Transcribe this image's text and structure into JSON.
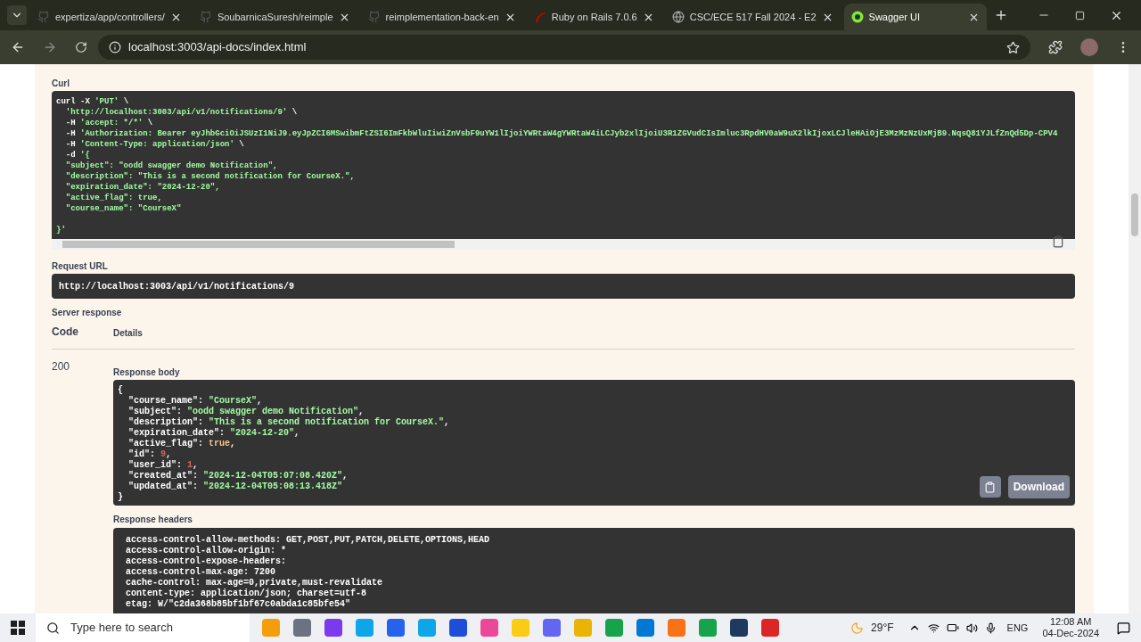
{
  "browser": {
    "tabs": [
      {
        "title": "expertiza/app/controllers/",
        "selected": false
      },
      {
        "title": "SoubarnicaSuresh/reimple",
        "selected": false
      },
      {
        "title": "reimplementation-back-en",
        "selected": false
      },
      {
        "title": "Ruby on Rails 7.0.6",
        "selected": false
      },
      {
        "title": "CSC/ECE 517 Fall 2024 - E2",
        "selected": false
      },
      {
        "title": "Swagger UI",
        "selected": true
      }
    ],
    "address": "localhost:3003/api-docs/index.html"
  },
  "curl": {
    "label": "Curl",
    "lines": [
      [
        {
          "t": "curl -X ",
          "kind": "plain"
        },
        {
          "t": "'PUT'",
          "kind": "str"
        },
        {
          "t": " \\",
          "kind": "plain"
        }
      ],
      [
        {
          "t": "  'http://localhost:3003/api/v1/notifications/9'",
          "kind": "str"
        },
        {
          "t": " \\",
          "kind": "plain"
        }
      ],
      [
        {
          "t": "  -H ",
          "kind": "plain"
        },
        {
          "t": "'accept: */*'",
          "kind": "str"
        },
        {
          "t": " \\",
          "kind": "plain"
        }
      ],
      [
        {
          "t": "  -H ",
          "kind": "plain"
        },
        {
          "t": "'Authorization: Bearer eyJhbGciOiJSUzI1NiJ9.eyJpZCI6MSwibmFtZSI6ImFkbWluIiwiZnVsbF9uYW1lIjoiYWRtaW4gYWRtaW4iLCJyb2xlIjoiU3R1ZGVudCIsImluc3RpdHV0aW9uX2lkIjoxLCJleHAiOjE3MzMzNzUxMjB9.NqsQ81YJLfZnQd5Dp-CPV4",
          "kind": "str"
        }
      ],
      [
        {
          "t": "  -H ",
          "kind": "plain"
        },
        {
          "t": "'Content-Type: application/json'",
          "kind": "str"
        },
        {
          "t": " \\",
          "kind": "plain"
        }
      ],
      [
        {
          "t": "  -d ",
          "kind": "plain"
        },
        {
          "t": "'{",
          "kind": "str"
        }
      ],
      [
        {
          "t": "  \"subject\": \"oodd swagger demo Notification\",",
          "kind": "str"
        }
      ],
      [
        {
          "t": "  \"description\": \"This is a second notification for CourseX.\",",
          "kind": "str"
        }
      ],
      [
        {
          "t": "  \"expiration_date\": \"2024-12-20\",",
          "kind": "str"
        }
      ],
      [
        {
          "t": "  \"active_flag\": true,",
          "kind": "str"
        }
      ],
      [
        {
          "t": "  \"course_name\": \"CourseX\"",
          "kind": "str"
        }
      ]
    ],
    "closing": "}'"
  },
  "request_url": {
    "label": "Request URL",
    "value": "http://localhost:3003/api/v1/notifications/9"
  },
  "server_response": {
    "label": "Server response",
    "columns": [
      "Code",
      "Details"
    ],
    "code": "200",
    "body_label": "Response body",
    "body_lines": [
      [
        {
          "t": "{",
          "kind": "plain"
        }
      ],
      [
        {
          "t": "  \"course_name\": ",
          "kind": "plain"
        },
        {
          "t": "\"CourseX\"",
          "kind": "str"
        },
        {
          "t": ",",
          "kind": "plain"
        }
      ],
      [
        {
          "t": "  \"subject\": ",
          "kind": "plain"
        },
        {
          "t": "\"oodd swagger demo Notification\"",
          "kind": "str"
        },
        {
          "t": ",",
          "kind": "plain"
        }
      ],
      [
        {
          "t": "  \"description\": ",
          "kind": "plain"
        },
        {
          "t": "\"This is a second notification for CourseX.\"",
          "kind": "str"
        },
        {
          "t": ",",
          "kind": "plain"
        }
      ],
      [
        {
          "t": "  \"expiration_date\": ",
          "kind": "plain"
        },
        {
          "t": "\"2024-12-20\"",
          "kind": "str"
        },
        {
          "t": ",",
          "kind": "plain"
        }
      ],
      [
        {
          "t": "  \"active_flag\": ",
          "kind": "plain"
        },
        {
          "t": "true",
          "kind": "bool"
        },
        {
          "t": ",",
          "kind": "plain"
        }
      ],
      [
        {
          "t": "  \"id\": ",
          "kind": "plain"
        },
        {
          "t": "9",
          "kind": "num"
        },
        {
          "t": ",",
          "kind": "plain"
        }
      ],
      [
        {
          "t": "  \"user_id\": ",
          "kind": "plain"
        },
        {
          "t": "1",
          "kind": "num"
        },
        {
          "t": ",",
          "kind": "plain"
        }
      ],
      [
        {
          "t": "  \"created_at\": ",
          "kind": "plain"
        },
        {
          "t": "\"2024-12-04T05:07:08.420Z\"",
          "kind": "str"
        },
        {
          "t": ",",
          "kind": "plain"
        }
      ],
      [
        {
          "t": "  \"updated_at\": ",
          "kind": "plain"
        },
        {
          "t": "\"2024-12-04T05:08:13.418Z\"",
          "kind": "str"
        }
      ],
      [
        {
          "t": "}",
          "kind": "plain"
        }
      ]
    ],
    "download": "Download",
    "headers_label": "Response headers",
    "headers": [
      "access-control-allow-methods: GET,POST,PUT,PATCH,DELETE,OPTIONS,HEAD",
      "access-control-allow-origin: *",
      "access-control-expose-headers:",
      "access-control-max-age: 7200",
      "cache-control: max-age=0,private,must-revalidate",
      "content-type: application/json; charset=utf-8",
      "etag: W/\"c2da368b85bf1bf67c0abda1c85bfe54\""
    ]
  },
  "taskbar": {
    "search_placeholder": "Type here to search",
    "weather": "29°F",
    "language": "ENG",
    "time": "12:08 AM",
    "date": "04-Dec-2024"
  }
}
